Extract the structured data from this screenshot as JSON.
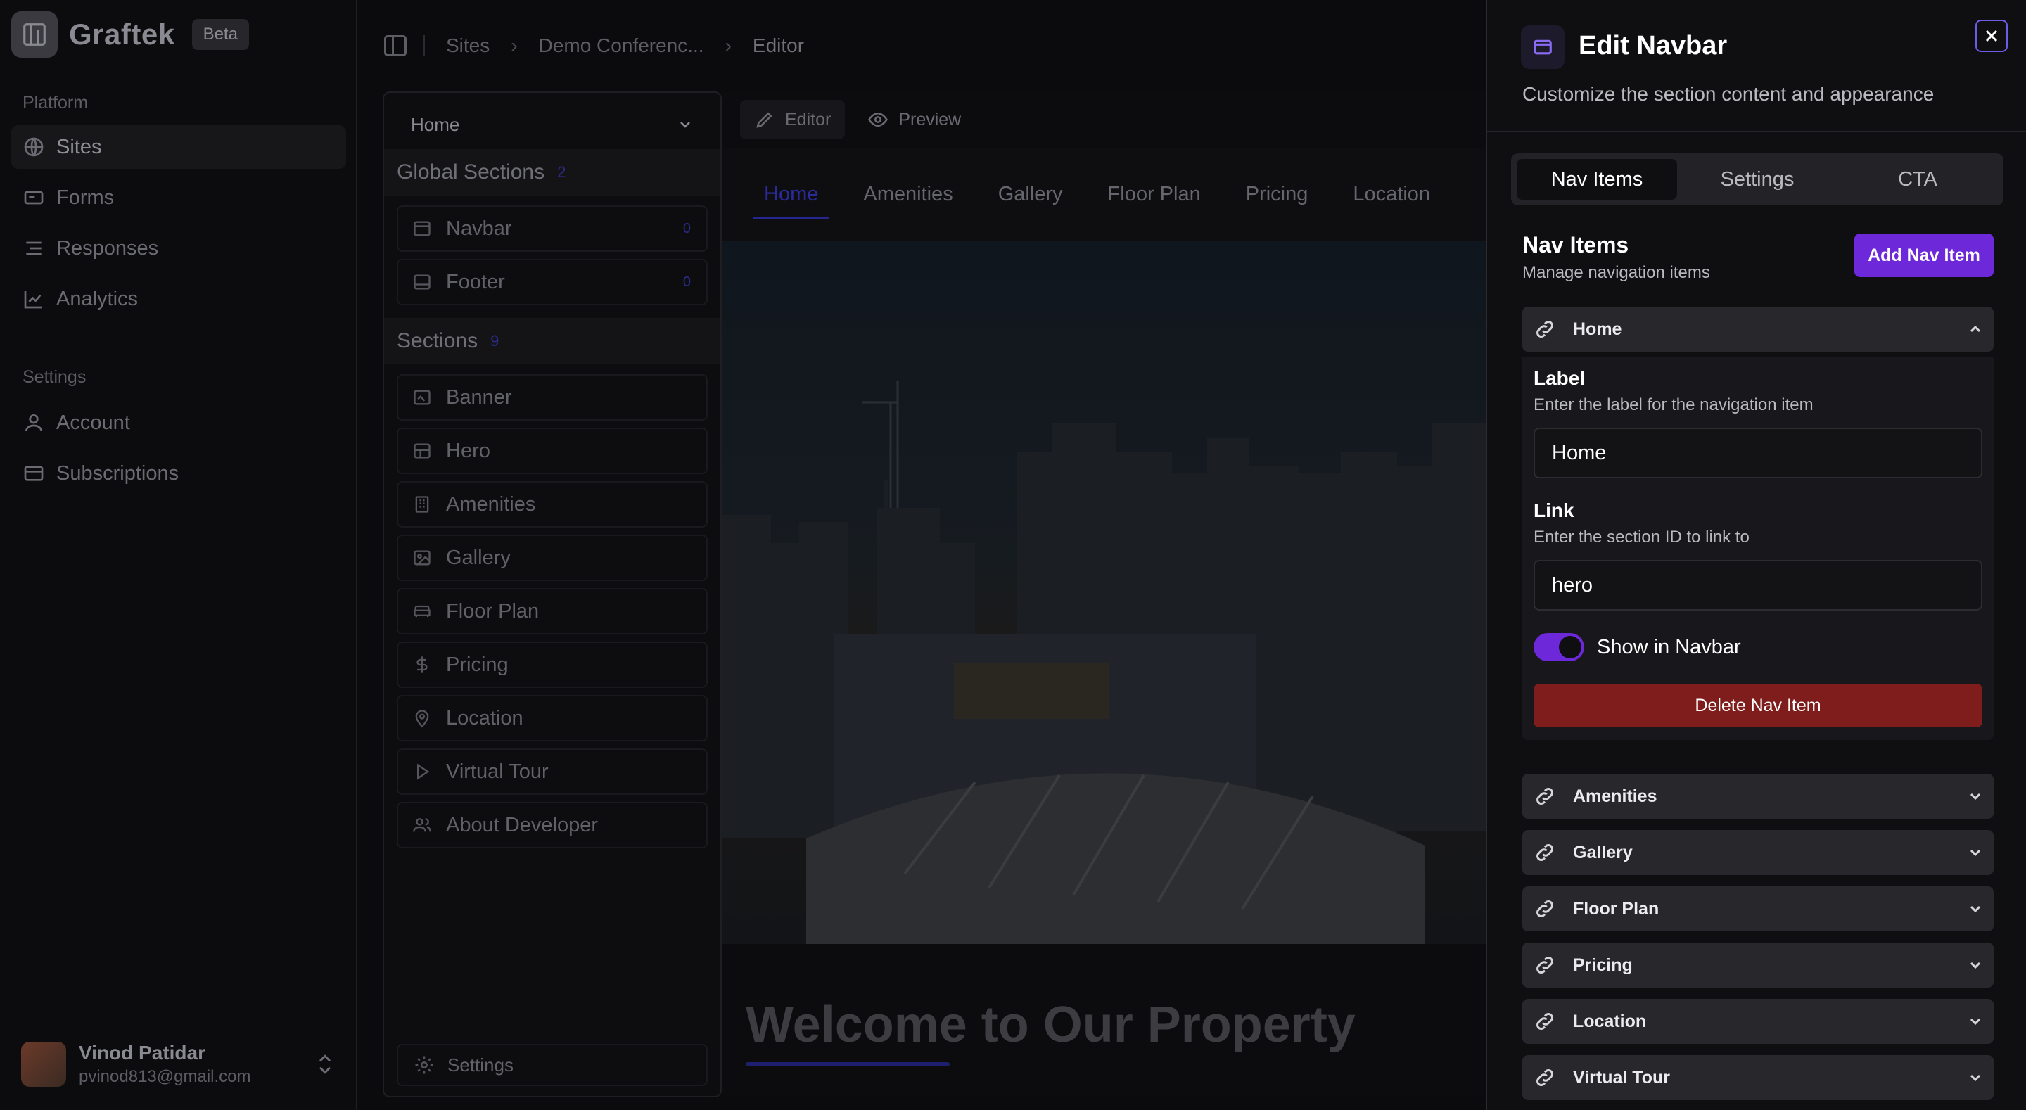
{
  "app": {
    "name": "Graftek",
    "badge": "Beta"
  },
  "sidebar": {
    "platform_label": "Platform",
    "settings_label": "Settings",
    "platform_items": [
      {
        "label": "Sites",
        "icon": "globe-icon"
      },
      {
        "label": "Forms",
        "icon": "card-icon"
      },
      {
        "label": "Responses",
        "icon": "list-icon"
      },
      {
        "label": "Analytics",
        "icon": "chart-icon"
      }
    ],
    "settings_items": [
      {
        "label": "Account",
        "icon": "user-icon"
      },
      {
        "label": "Subscriptions",
        "icon": "credit-card-icon"
      }
    ],
    "user": {
      "name": "Vinod Patidar",
      "email": "pvinod813@gmail.com"
    }
  },
  "breadcrumb": {
    "items": [
      "Sites",
      "Demo Conferenc...",
      "Editor"
    ]
  },
  "sections_panel": {
    "page_select": "Home",
    "global_title": "Global Sections",
    "global_count": "2",
    "global_items": [
      {
        "label": "Navbar",
        "badge": "0"
      },
      {
        "label": "Footer",
        "badge": "0"
      }
    ],
    "sections_title": "Sections",
    "sections_count": "9",
    "section_items": [
      {
        "label": "Banner"
      },
      {
        "label": "Hero"
      },
      {
        "label": "Amenities"
      },
      {
        "label": "Gallery"
      },
      {
        "label": "Floor Plan"
      },
      {
        "label": "Pricing"
      },
      {
        "label": "Location"
      },
      {
        "label": "Virtual Tour"
      },
      {
        "label": "About Developer"
      }
    ],
    "settings_label": "Settings"
  },
  "canvas": {
    "editor_label": "Editor",
    "preview_label": "Preview",
    "site_nav": [
      "Home",
      "Amenities",
      "Gallery",
      "Floor Plan",
      "Pricing",
      "Location"
    ],
    "welcome_heading": "Welcome to Our Property"
  },
  "drawer": {
    "title": "Edit Navbar",
    "subtitle": "Customize the section content and appearance",
    "tabs": [
      "Nav Items",
      "Settings",
      "CTA"
    ],
    "section_title": "Nav Items",
    "section_subtitle": "Manage navigation items",
    "add_button": "Add Nav Item",
    "expanded_item": {
      "title": "Home",
      "label_title": "Label",
      "label_help": "Enter the label for the navigation item",
      "label_value": "Home",
      "link_title": "Link",
      "link_help": "Enter the section ID to link to",
      "link_value": "hero",
      "toggle_label": "Show in Navbar",
      "toggle_on": true,
      "delete_button": "Delete Nav Item"
    },
    "collapsed_items": [
      "Amenities",
      "Gallery",
      "Floor Plan",
      "Pricing",
      "Location",
      "Virtual Tour"
    ]
  },
  "colors": {
    "accent": "#6d28d9",
    "danger": "#7f1d1d"
  }
}
